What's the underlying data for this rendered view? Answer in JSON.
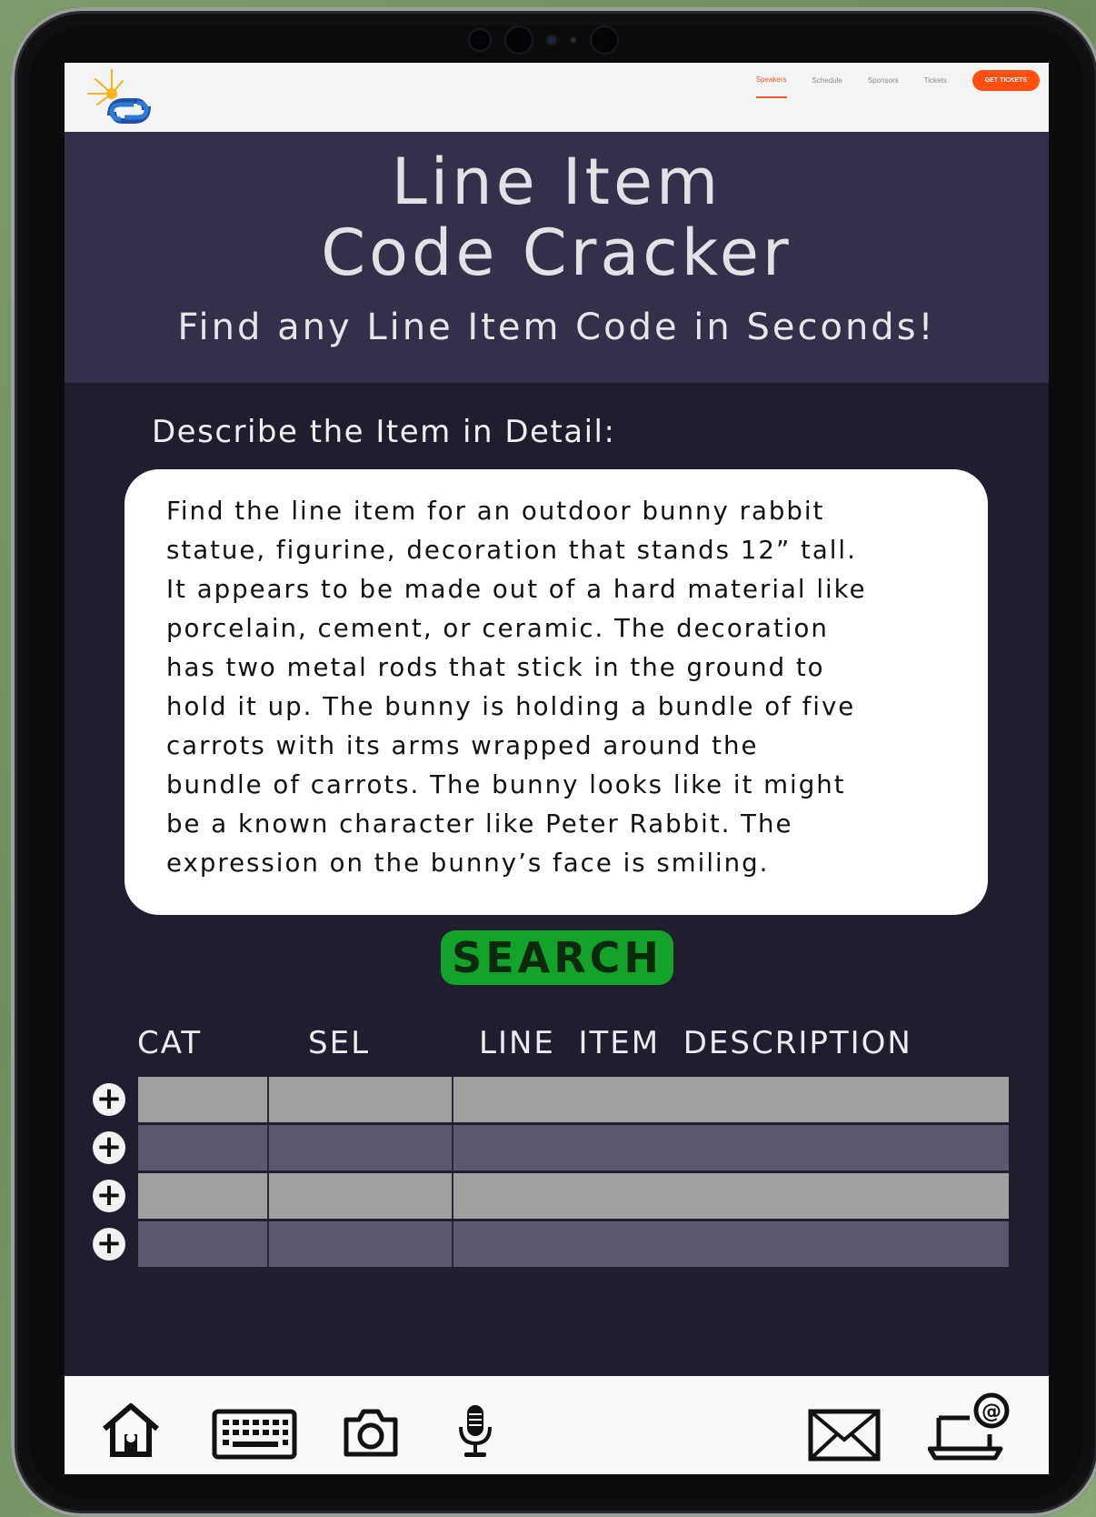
{
  "nav": {
    "links": [
      "Speakers",
      "Schedule",
      "Sponsors",
      "Tickets"
    ],
    "cta": "GET TICKETS"
  },
  "hero": {
    "title_line1": "Line Item",
    "title_line2": "Code Cracker",
    "subtitle": "Find any Line Item Code in Seconds!"
  },
  "form": {
    "label": "Describe the Item in Detail:",
    "description": "Find the line item for an outdoor bunny rabbit\nstatue, figurine, decoration that stands 12” tall.\nIt appears to be made out of a hard material like\nporcelain, cement, or ceramic. The decoration\nhas two metal rods that stick in the ground to\nhold it up. The bunny is holding a bundle of five\ncarrots with its arms wrapped around the\nbundle of carrots. The bunny looks like it might\nbe a known character like Peter Rabbit. The\nexpression on the bunny’s face is smiling.",
    "search_label": "SEARCH"
  },
  "results": {
    "headers": [
      "CAT",
      "SEL",
      "LINE  ITEM  DESCRIPTION"
    ],
    "add_symbol": "+",
    "rows": [
      {
        "cat": "",
        "sel": "",
        "desc": ""
      },
      {
        "cat": "",
        "sel": "",
        "desc": ""
      },
      {
        "cat": "",
        "sel": "",
        "desc": ""
      },
      {
        "cat": "",
        "sel": "",
        "desc": ""
      }
    ]
  },
  "bottom_bar": {
    "icons": [
      "home-icon",
      "keyboard-icon",
      "camera-icon",
      "microphone-icon",
      "mail-icon",
      "laptop-at-icon"
    ]
  },
  "colors": {
    "accent": "#ff4e12",
    "search": "#13a32a",
    "hero_bg": "#33304a",
    "page_bg": "#201e2e",
    "row_light": "#a0a0a0",
    "row_dark": "#5c5870"
  }
}
